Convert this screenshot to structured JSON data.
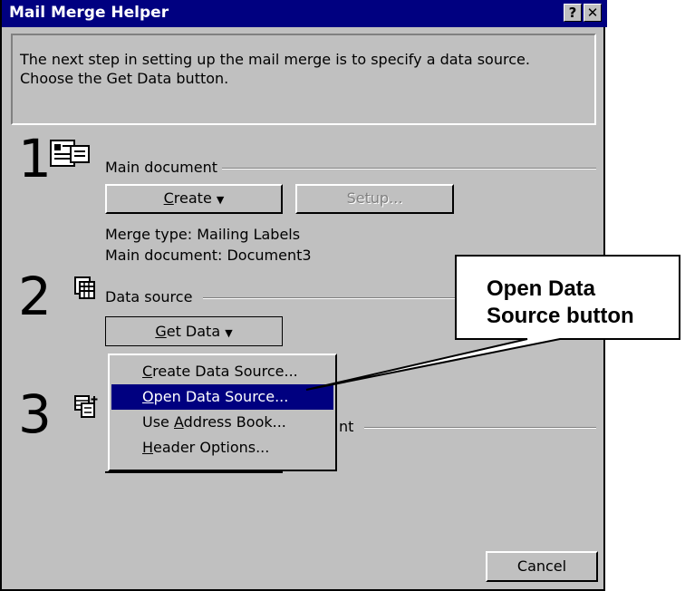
{
  "window": {
    "title": "Mail Merge Helper",
    "help_glyph": "?",
    "close_glyph": "✕"
  },
  "message": "The next step in setting up the mail merge is to specify a data source.\nChoose the Get Data button.",
  "steps": [
    {
      "number": "1",
      "label": "Main document",
      "icon": "main-document-icon"
    },
    {
      "number": "2",
      "label": "Data source",
      "icon": "data-source-icon"
    },
    {
      "number": "3",
      "label": "nt",
      "icon": "merge-icon"
    }
  ],
  "main_document": {
    "create_label": "Create",
    "setup_label": "Setup...",
    "merge_type": "Merge type: Mailing Labels",
    "main_doc": "Main document: Document3"
  },
  "data_source": {
    "get_data_label": "Get Data"
  },
  "menu": {
    "items": [
      {
        "pre": "",
        "key": "C",
        "post": "reate Data Source..."
      },
      {
        "pre": "",
        "key": "O",
        "post": "pen Data Source..."
      },
      {
        "pre": "Use ",
        "key": "A",
        "post": "ddress Book..."
      },
      {
        "pre": "",
        "key": "H",
        "post": "eader Options..."
      }
    ],
    "selected_index": 1
  },
  "cancel_label": "Cancel",
  "callout": {
    "line1": "Open Data",
    "line2": "Source button"
  }
}
